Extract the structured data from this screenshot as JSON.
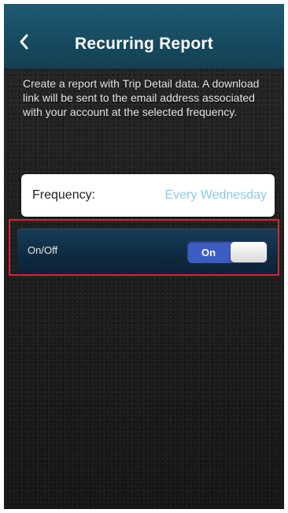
{
  "header": {
    "title": "Recurring Report",
    "back_icon": "chevron-left-icon"
  },
  "description": "Create a report with Trip Detail data. A download link will be sent to the email address associated with your account at the selected frequency.",
  "frequency": {
    "label": "Frequency:",
    "value": "Every Wednesday"
  },
  "toggle": {
    "label": "On/Off",
    "state_label": "On",
    "on": true
  },
  "colors": {
    "navbar": "#1e5a72",
    "accent_value": "#8fc7e6",
    "switch_on": "#3d5cc2",
    "highlight": "#d6262e"
  }
}
